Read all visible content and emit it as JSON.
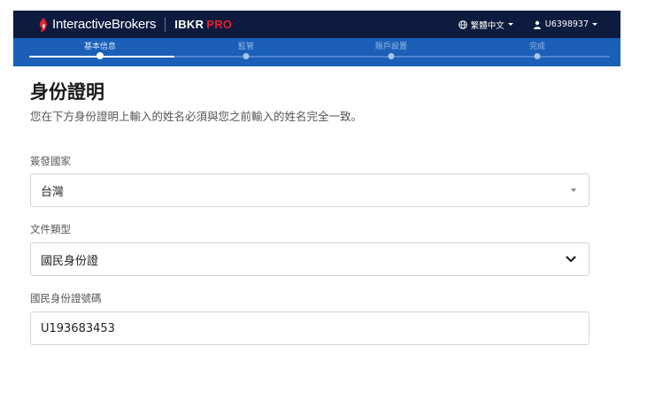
{
  "header": {
    "brand_name": "InteractiveBrokers",
    "product_prefix": "IBKR",
    "product_suffix": "PRO",
    "language": "繁體中文",
    "username": "U6398937"
  },
  "steps": [
    {
      "label": "基本信息",
      "active": true
    },
    {
      "label": "監管",
      "active": false
    },
    {
      "label": "賬戶設置",
      "active": false
    },
    {
      "label": "完成",
      "active": false
    }
  ],
  "page": {
    "title": "身份證明",
    "description": "您在下方身份證明上輸入的姓名必須與您之前輸入的姓名完全一致。"
  },
  "form": {
    "country": {
      "label": "簽發國家",
      "value": "台灣"
    },
    "doc_type": {
      "label": "文件類型",
      "value": "國民身份證"
    },
    "id_number": {
      "label": "國民身份證號碼",
      "value": "U193683453"
    }
  },
  "colors": {
    "topbar": "#0d1b3e",
    "stepbar": "#1b5fb8",
    "brand_red": "#e8212e"
  },
  "icons": {
    "logo": "flame-logo-icon",
    "language": "globe-icon",
    "user": "user-icon",
    "country_dropdown": "caret-down-icon",
    "doc_dropdown": "chevron-down-icon"
  }
}
